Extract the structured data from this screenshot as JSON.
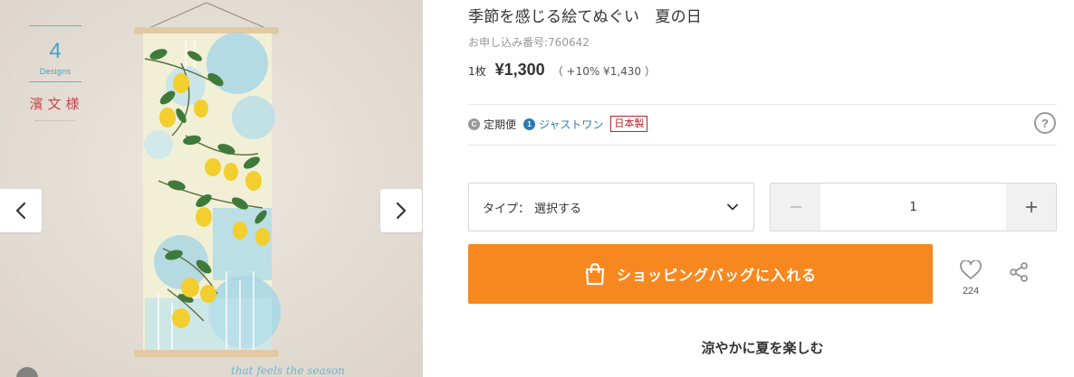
{
  "gallery": {
    "badge_number": "4",
    "badge_subtitle": "Designs",
    "badge_brand": "濱文様",
    "prev_icon": "chevron-left-icon",
    "next_icon": "chevron-right-icon",
    "colors": {
      "wall": "#e6e0d8",
      "accent": "#3fa5c8",
      "brand_red": "#c9464e"
    }
  },
  "product": {
    "title": "季節を感じる絵てぬぐい　夏の日",
    "order_no": "お申し込み番号:760642",
    "unit": "1枚",
    "price": "¥1,300",
    "tax_note": "（ +10%  ¥1,430 ）"
  },
  "services": {
    "teiki": "定期便",
    "just_town": "ジャストワン",
    "made_in": "日本製",
    "help_icon": "question-circle-icon"
  },
  "purchase": {
    "type_label": "タイプ：",
    "type_value": "選択する",
    "quantity": "1",
    "cart_label": "ショッピングバッグに入れる",
    "favorite_count": "224",
    "colors": {
      "cart": "#f7881f"
    }
  },
  "description": {
    "headline": "涼やかに夏を楽しむ"
  }
}
